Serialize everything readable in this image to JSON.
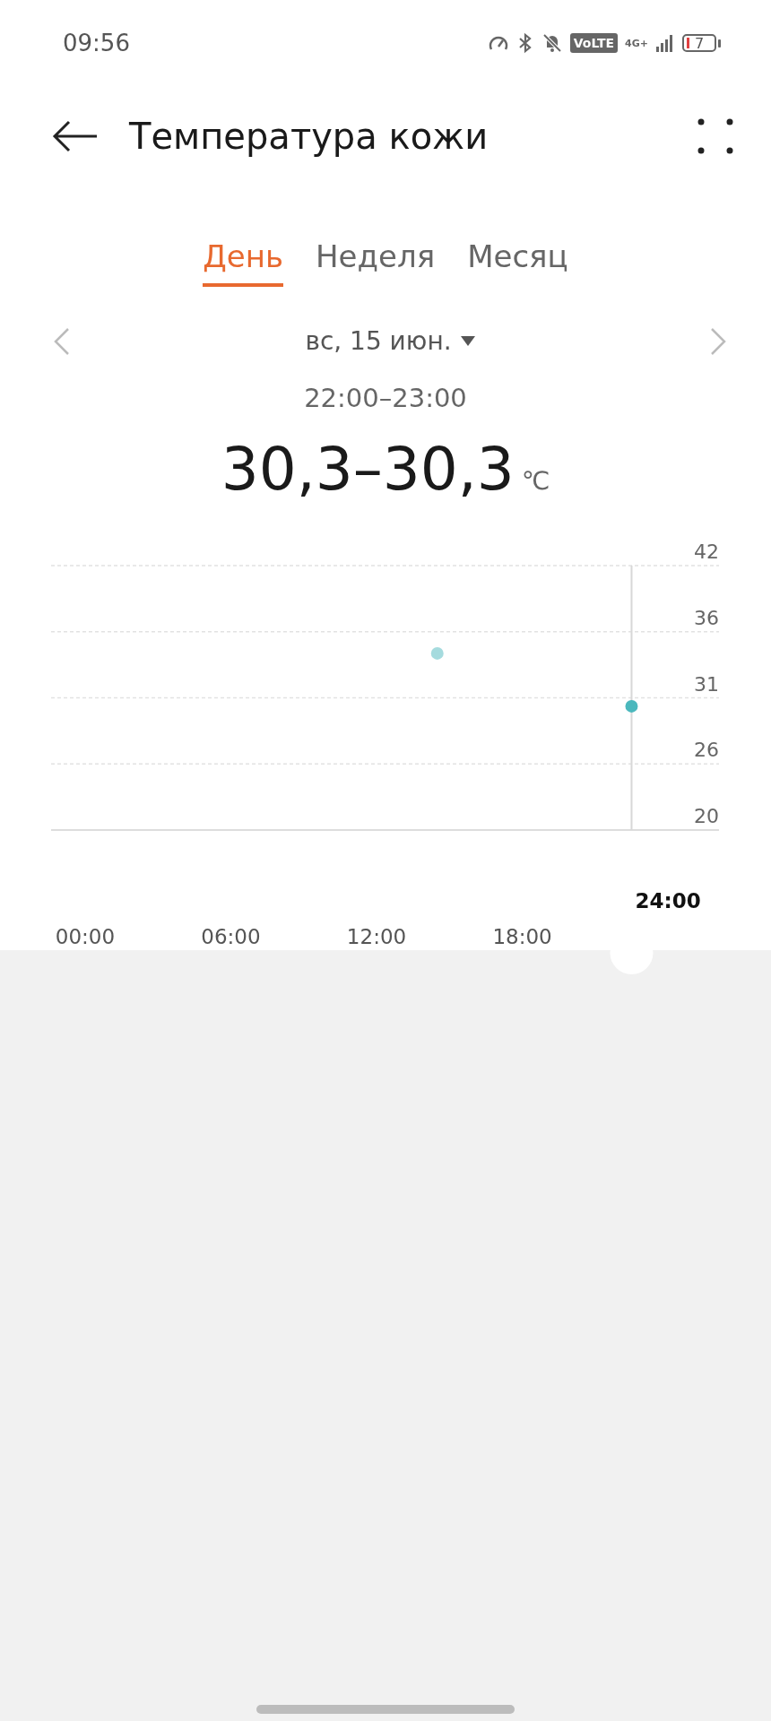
{
  "status_bar": {
    "time": "09:56",
    "volte": "VoLTE",
    "network": "4G+",
    "battery": "7"
  },
  "header": {
    "title": "Температура кожи"
  },
  "tabs": [
    {
      "label": "День",
      "selected": true
    },
    {
      "label": "Неделя",
      "selected": false
    },
    {
      "label": "Месяц",
      "selected": false
    }
  ],
  "date": {
    "label": "вс, 15 июн."
  },
  "range": {
    "time": "22:00–23:00",
    "value": "30,3–30,3",
    "unit": "℃"
  },
  "chart_data": {
    "type": "scatter",
    "x": [
      14.5,
      22.5
    ],
    "series": [
      {
        "color": "#4bb8bd",
        "values": [
          34.7,
          30.3
        ]
      }
    ],
    "xlim": [
      -1.4,
      26.1
    ],
    "ylim": [
      20,
      42
    ],
    "xticks": [
      {
        "value": 0,
        "label": "00:00"
      },
      {
        "value": 6,
        "label": "06:00"
      },
      {
        "value": 12,
        "label": "12:00"
      },
      {
        "value": 18,
        "label": "18:00"
      }
    ],
    "yticks": [
      {
        "value": 20,
        "label": "20"
      },
      {
        "value": 25.5,
        "label": "26"
      },
      {
        "value": 31,
        "label": "31"
      },
      {
        "value": 36.5,
        "label": "36"
      },
      {
        "value": 42,
        "label": "42"
      }
    ],
    "grid": true,
    "ref_lines": [
      {
        "axis": "x",
        "value": 22.5
      }
    ]
  },
  "slider": {
    "label": "24:00"
  }
}
